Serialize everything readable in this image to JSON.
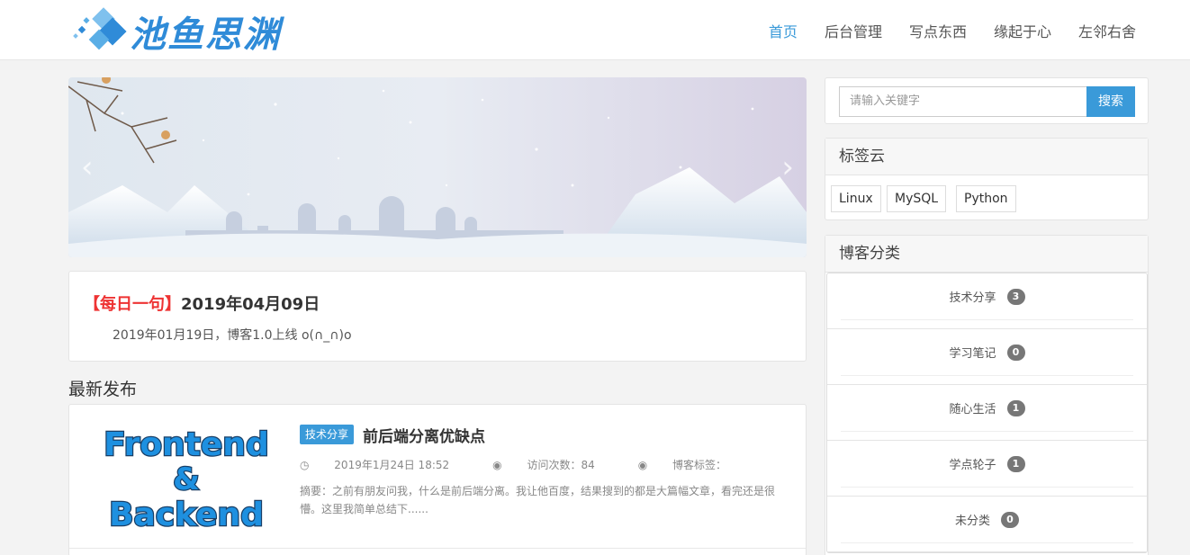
{
  "header": {
    "logo_text": "池鱼思渊",
    "nav": [
      "首页",
      "后台管理",
      "写点东西",
      "缘起于心",
      "左邻右舍"
    ],
    "active_index": 0
  },
  "daily": {
    "tag": "【每日一句】",
    "date": "2019年04月09日",
    "text": "2019年01月19日，博客1.0上线 o(∩_∩)o"
  },
  "latest": {
    "title": "最新发布",
    "articles": [
      {
        "thumbnail_words": [
          "Frontend",
          "&",
          "Backend"
        ],
        "category": "技术分享",
        "title": "前后端分离优缺点",
        "datetime": "2019年1月24日 18:52",
        "views": "访问次数：84",
        "tags_label": "博客标签：",
        "excerpt": "摘要：之前有朋友问我，什么是前后端分离。我让他百度，结果搜到的都是大篇幅文章，看完还是很懵。这里我简单总结下......"
      }
    ]
  },
  "sidebar": {
    "search": {
      "placeholder": "请输入关键字",
      "button": "搜索"
    },
    "tag_cloud": {
      "title": "标签云",
      "tags": [
        "Linux",
        "MySQL",
        "Python"
      ]
    },
    "categories": {
      "title": "博客分类",
      "items": [
        {
          "name": "技术分享",
          "count": "3"
        },
        {
          "name": "学习笔记",
          "count": "0"
        },
        {
          "name": "随心生活",
          "count": "1"
        },
        {
          "name": "学点轮子",
          "count": "1"
        },
        {
          "name": "未分类",
          "count": "0"
        }
      ]
    }
  },
  "colors": {
    "accent": "#3a9ad9",
    "daily_tag": "#ee3333",
    "badge": "#777777"
  },
  "icons": {
    "clock": "clock-icon",
    "views": "eye-icon",
    "tags": "eye-icon",
    "prev": "chevron-left-icon",
    "next": "chevron-right-icon"
  }
}
